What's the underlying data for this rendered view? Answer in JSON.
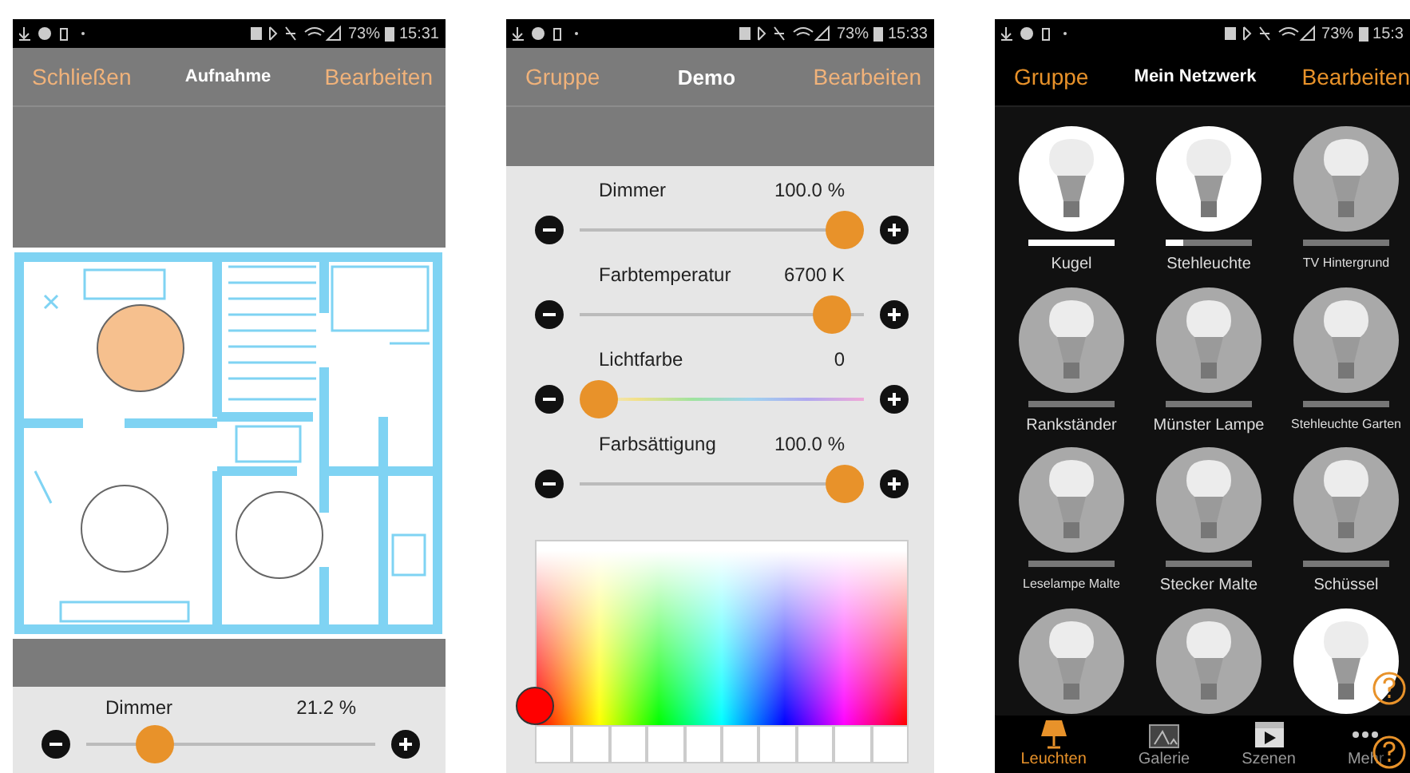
{
  "floorplan_screen": {
    "status_bar": {
      "battery": "73%",
      "time": "15:31"
    },
    "header": {
      "left": "Schließen",
      "title": "Aufnahme",
      "right": "Bearbeiten"
    },
    "slider": {
      "label": "Dimmer",
      "reading": "21.2 %",
      "level": 0.2
    }
  },
  "demo_screen": {
    "status_bar": {
      "battery": "73%",
      "time": "15:33"
    },
    "header": {
      "left": "Gruppe",
      "title": "Demo",
      "right": "Bearbeiten"
    },
    "sliders": [
      {
        "label": "Dimmer",
        "reading": "100.0 %",
        "level": 1,
        "kind": "plain"
      },
      {
        "label": "Farbtemperatur",
        "reading": "6700 K",
        "level": 0.95,
        "kind": "plain"
      },
      {
        "label": "Lichtfarbe",
        "reading": "0",
        "level": 0,
        "kind": "hue"
      },
      {
        "label": "Farbsättigung",
        "reading": "100.0 %",
        "level": 1,
        "kind": "plain"
      }
    ]
  },
  "network_screen": {
    "status_bar": {
      "battery": "73%",
      "time": "15:3"
    },
    "header": {
      "left": "Gruppe",
      "title": "Mein Netzwerk",
      "right": "Bearbeiten"
    },
    "lamps": [
      {
        "name": "Kugel",
        "on": true,
        "level": 1
      },
      {
        "name": "Stehleuchte",
        "on": true,
        "level": 0.2
      },
      {
        "name": "TV Hintergrund",
        "on": false,
        "level": 0
      },
      {
        "name": "Rankständer",
        "on": false,
        "level": 0
      },
      {
        "name": "Münster Lampe",
        "on": false,
        "level": 0
      },
      {
        "name": "Stehleuchte Garten",
        "on": false,
        "level": 0
      },
      {
        "name": "Leselampe Malte",
        "on": false,
        "level": 0
      },
      {
        "name": "Stecker Malte",
        "on": false,
        "level": 0
      },
      {
        "name": "Schüssel",
        "on": false,
        "level": 0
      },
      {
        "on": false
      },
      {
        "on": false
      },
      {
        "on": true
      }
    ],
    "tabs": [
      {
        "label": "Leuchten",
        "selected": true,
        "kind": "lamp"
      },
      {
        "label": "Galerie",
        "selected": false,
        "kind": "gallery"
      },
      {
        "label": "Szenen",
        "selected": false,
        "kind": "scenes"
      },
      {
        "label": "Mehr",
        "selected": false,
        "kind": "more"
      }
    ]
  }
}
